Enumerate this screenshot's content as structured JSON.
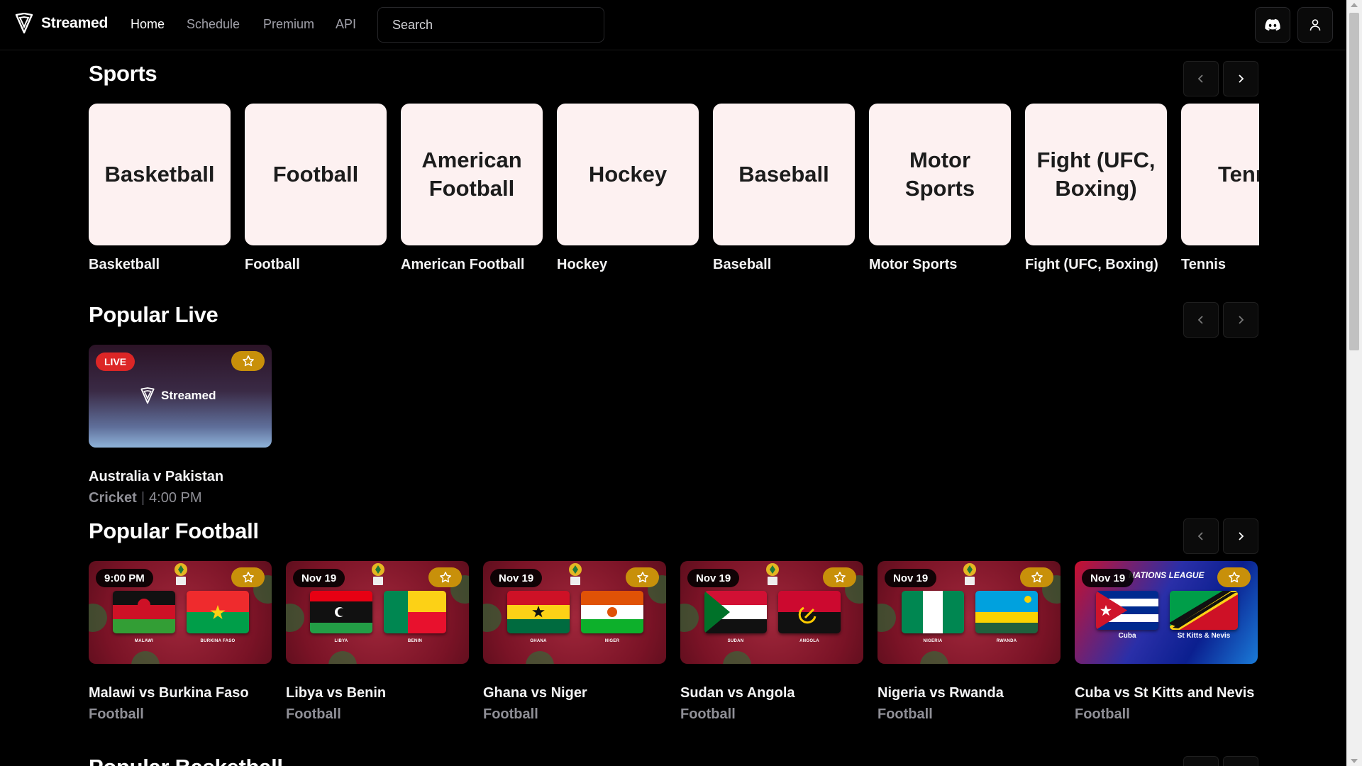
{
  "app": {
    "brand": "Streamed"
  },
  "nav": {
    "links": [
      "Home",
      "Schedule",
      "Premium",
      "API"
    ],
    "active": "Home",
    "search_placeholder": "Search"
  },
  "sports": {
    "title": "Sports",
    "items": [
      {
        "tile": "Basketball",
        "label": "Basketball"
      },
      {
        "tile": "Football",
        "label": "Football"
      },
      {
        "tile": "American Football",
        "label": "American Football"
      },
      {
        "tile": "Hockey",
        "label": "Hockey"
      },
      {
        "tile": "Baseball",
        "label": "Baseball"
      },
      {
        "tile": "Motor Sports",
        "label": "Motor Sports"
      },
      {
        "tile": "Fight (UFC, Boxing)",
        "label": "Fight (UFC, Boxing)"
      },
      {
        "tile": "Tennis",
        "label": "Tennis"
      }
    ]
  },
  "popular_live": {
    "title": "Popular Live",
    "items": [
      {
        "badge": "LIVE",
        "thumb_text": "Streamed",
        "title": "Australia v Pakistan",
        "category": "Cricket",
        "time": "4:00 PM"
      }
    ]
  },
  "popular_football": {
    "title": "Popular Football",
    "items": [
      {
        "badge": "9:00 PM",
        "title": "Malawi vs Burkina Faso",
        "category": "Football",
        "home_team": "MALAWI",
        "away_team": "BURKINA FASO"
      },
      {
        "badge": "Nov 19",
        "title": "Libya vs Benin",
        "category": "Football",
        "home_team": "LIBYA",
        "away_team": "BENIN"
      },
      {
        "badge": "Nov 19",
        "title": "Ghana vs Niger",
        "category": "Football",
        "home_team": "GHANA",
        "away_team": "NIGER"
      },
      {
        "badge": "Nov 19",
        "title": "Sudan vs Angola",
        "category": "Football",
        "home_team": "SUDAN",
        "away_team": "ANGOLA"
      },
      {
        "badge": "Nov 19",
        "title": "Nigeria vs Rwanda",
        "category": "Football",
        "home_team": "NIGERIA",
        "away_team": "RWANDA"
      },
      {
        "badge": "Nov 19",
        "title": "Cuba vs St Kitts and Nevis",
        "category": "Football",
        "home_team": "Cuba",
        "away_team": "St Kitts & Nevis",
        "league_text": "NATIONS LEAGUE"
      }
    ]
  },
  "next_section": {
    "title": "Popular Basketball"
  },
  "colors": {
    "background": "#000000",
    "tile": "#fdf1f1",
    "live": "#dc2626",
    "favorite": "#c8900a",
    "muted": "#8f8f96"
  },
  "icons": [
    "streamed-logo-icon",
    "discord-icon",
    "user-icon",
    "chevron-left-icon",
    "chevron-right-icon",
    "star-icon"
  ]
}
